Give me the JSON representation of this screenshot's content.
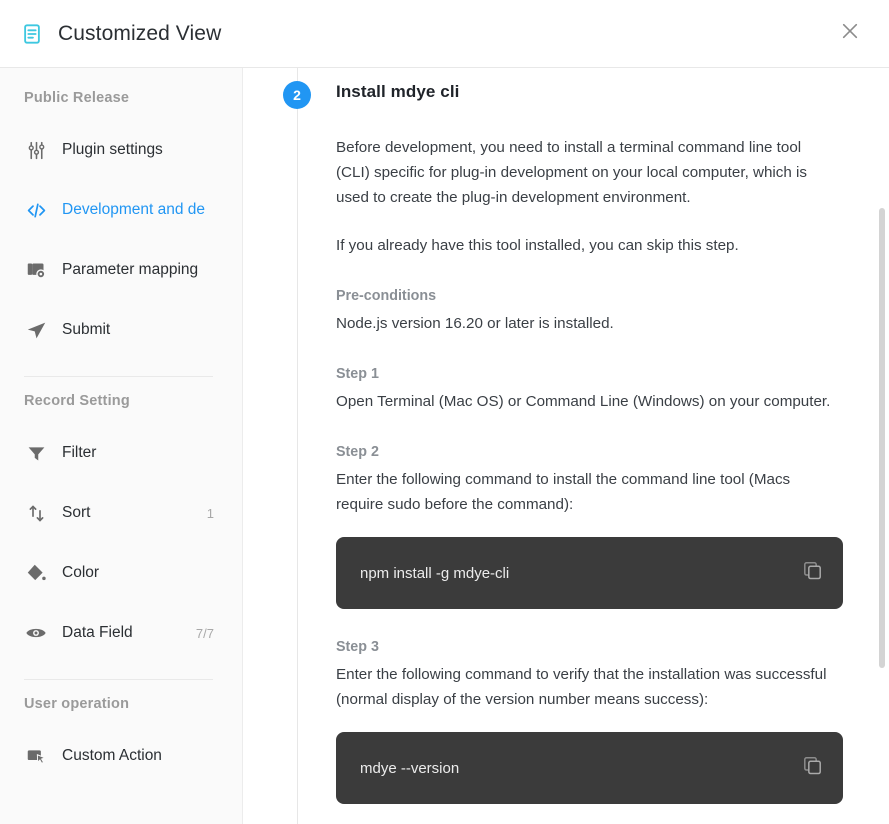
{
  "header": {
    "icon": "document-list-icon",
    "title": "Customized View",
    "close_icon": "close-icon",
    "icon_color": "#3ec8e0"
  },
  "sidebar": {
    "sections": [
      {
        "title": "Public Release",
        "items": [
          {
            "label": "Plugin settings",
            "icon": "sliders-icon",
            "meta": "",
            "active": false
          },
          {
            "label": "Development and de",
            "icon": "code-brackets-icon",
            "meta": "",
            "active": true
          },
          {
            "label": "Parameter mapping",
            "icon": "layers-gear-icon",
            "meta": "",
            "active": false
          },
          {
            "label": "Submit",
            "icon": "send-icon",
            "meta": "",
            "active": false
          }
        ]
      },
      {
        "title": "Record Setting",
        "items": [
          {
            "label": "Filter",
            "icon": "funnel-icon",
            "meta": "",
            "active": false
          },
          {
            "label": "Sort",
            "icon": "sort-arrows-icon",
            "meta": "1",
            "active": false
          },
          {
            "label": "Color",
            "icon": "paint-bucket-icon",
            "meta": "",
            "active": false
          },
          {
            "label": "Data Field",
            "icon": "eye-icon",
            "meta": "7/7",
            "active": false
          }
        ]
      },
      {
        "title": "User operation",
        "items": [
          {
            "label": "Custom Action",
            "icon": "cursor-rect-icon",
            "meta": "",
            "active": false
          }
        ]
      }
    ]
  },
  "main": {
    "step_number": "2",
    "step_title": "Install mdye cli",
    "accent_color": "#2196f3",
    "paragraphs": [
      "Before development, you need to install a terminal command line tool (CLI) specific for plug-in development on your local computer, which is used to create the plug-in development environment.",
      "If you already have this tool installed, you can skip this step."
    ],
    "preconditions_heading": "Pre-conditions",
    "preconditions_text": "Node.js version 16.20 or later is installed.",
    "steps": [
      {
        "heading": "Step 1",
        "text": "Open Terminal (Mac OS) or Command Line (Windows) on your computer.",
        "code": null
      },
      {
        "heading": "Step 2",
        "text": "Enter the following command to install the command line tool (Macs require sudo before the command):",
        "code": "npm install -g mdye-cli",
        "copy_icon": "copy-icon"
      },
      {
        "heading": "Step 3",
        "text": "Enter the following command to verify that the installation was successful (normal display of the version number means success):",
        "code": "mdye --version",
        "copy_icon": "copy-icon"
      }
    ],
    "code_background": "#3b3b3b"
  },
  "scrollbar": {
    "name": "vertical-scrollbar"
  }
}
